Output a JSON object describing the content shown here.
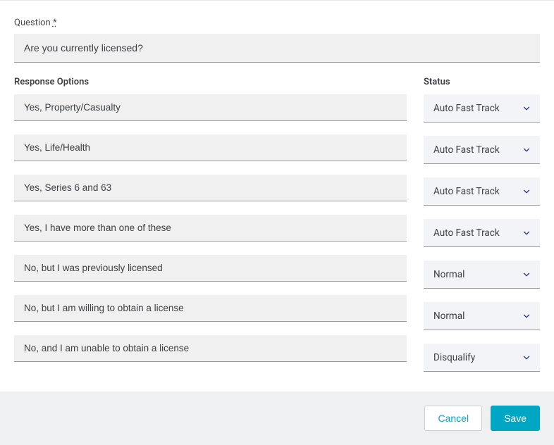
{
  "question": {
    "label": "Question",
    "required_marker": "*",
    "value": "Are you currently licensed?"
  },
  "headers": {
    "response_options": "Response Options",
    "status": "Status"
  },
  "options": [
    {
      "text": "Yes, Property/Casualty",
      "status": "Auto Fast Track"
    },
    {
      "text": "Yes, Life/Health",
      "status": "Auto Fast Track"
    },
    {
      "text": "Yes, Series 6 and 63",
      "status": "Auto Fast Track"
    },
    {
      "text": "Yes, I have more than one of these",
      "status": "Auto Fast Track"
    },
    {
      "text": "No, but I was previously licensed",
      "status": "Normal"
    },
    {
      "text": "No, but I am willing to obtain a license",
      "status": "Normal"
    },
    {
      "text": "No, and I am unable to obtain a license",
      "status": "Disqualify"
    }
  ],
  "buttons": {
    "cancel": "Cancel",
    "save": "Save"
  }
}
